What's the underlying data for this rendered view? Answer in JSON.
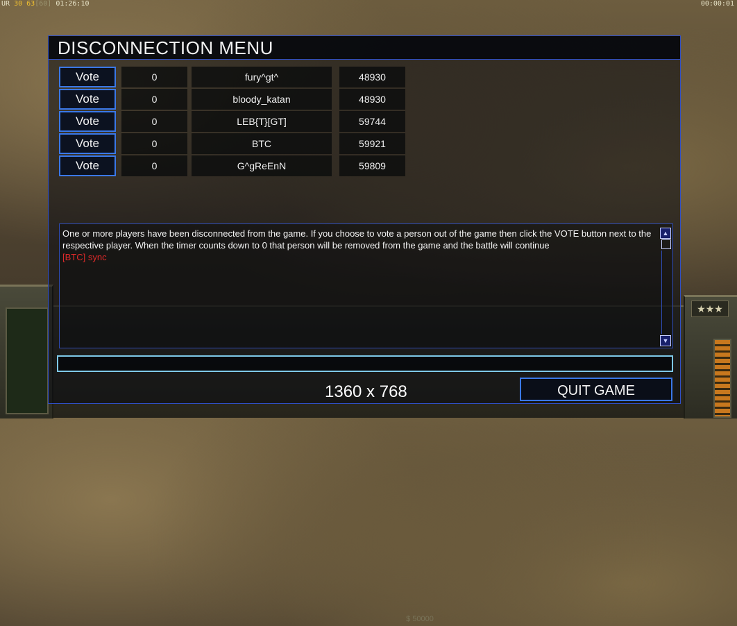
{
  "status": {
    "left_ur": "UR",
    "left_val1": "30",
    "left_val2": "63",
    "left_bracket": "[60]",
    "left_time": "01:26:10",
    "right_time": "00:00:01"
  },
  "hud": {
    "center_readout": "$ 50000",
    "rank_stars": "★★★",
    "rank_icon": "★"
  },
  "dialog": {
    "title": "DISCONNECTION MENU",
    "vote_label": "Vote",
    "players": [
      {
        "count": "0",
        "name": "fury^gt^",
        "ping": "48930"
      },
      {
        "count": "0",
        "name": "bloody_katan",
        "ping": "48930"
      },
      {
        "count": "0",
        "name": "LEB{T}[GT]",
        "ping": "59744"
      },
      {
        "count": "0",
        "name": "BTC",
        "ping": "59921"
      },
      {
        "count": "0",
        "name": "G^gReEnN",
        "ping": "59809"
      }
    ],
    "message": "One or more players have been disconnected from the game. If you choose to vote a person out of the game then click the VOTE button next to the respective player. When the timer counts down to 0 that person will be removed from the game and the battle will continue",
    "message_red": "[BTC] sync",
    "chat_value": "",
    "quit_label": "QUIT GAME"
  },
  "resolution_label": "1360 x 768",
  "colors": {
    "accent_blue": "#3a78e8",
    "input_cyan": "#7ec8e8",
    "alert_red": "#e02a2a"
  }
}
